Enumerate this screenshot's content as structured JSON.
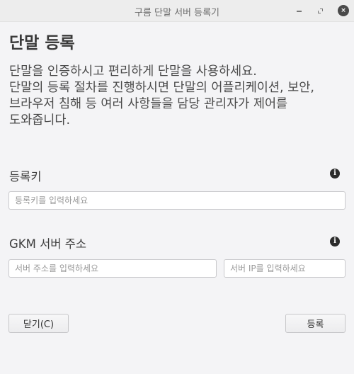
{
  "window": {
    "title": "구름 단말 서버 등록기",
    "minimize_icon": "minimize-icon",
    "maximize_icon": "maximize-icon",
    "close_icon": "close-icon",
    "close_glyph": "×"
  },
  "heading": "단말 등록",
  "description": {
    "lines": [
      "단말을 인증하시고 편리하게 단말을 사용하세요.",
      "단말의 등록 절차를 진행하시면 단말의 어플리케이션, 보안,",
      "브라우저 침해 등 여러 사항들을 담당 관리자가 제어를",
      "도와줍니다."
    ]
  },
  "registration_key": {
    "label": "등록키",
    "placeholder": "등록키를 입력하세요",
    "value": "",
    "info_icon": "info-icon"
  },
  "gkm_server": {
    "label": "GKM 서버 주소",
    "address_placeholder": "서버 주소를 입력하세요",
    "ip_placeholder": "서버 IP를 입력하세요",
    "info_icon": "info-icon"
  },
  "buttons": {
    "close": "닫기(C)",
    "register": "등록"
  }
}
